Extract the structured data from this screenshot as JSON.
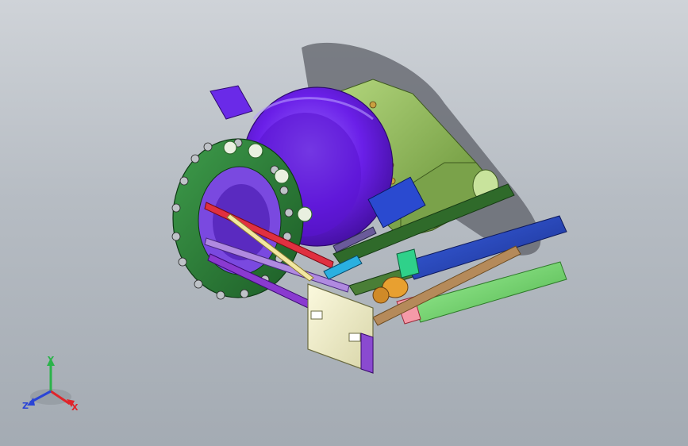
{
  "triad": {
    "x_label": "X",
    "y_label": "Y",
    "z_label": "Z",
    "x_color": "#e0242a",
    "y_color": "#2bb34a",
    "z_color": "#2b45d6"
  },
  "viewport": {
    "background_top": "#cfd3d8",
    "background_bottom": "#a4abb3"
  },
  "model": {
    "turbine_color": "#6a1fe8",
    "housing_color": "#8db85a",
    "flange_color": "#2f8a3c",
    "plate_color": "#f3f1cc",
    "rail_blue": "#2347c8",
    "rail_green": "#7fd77a"
  }
}
